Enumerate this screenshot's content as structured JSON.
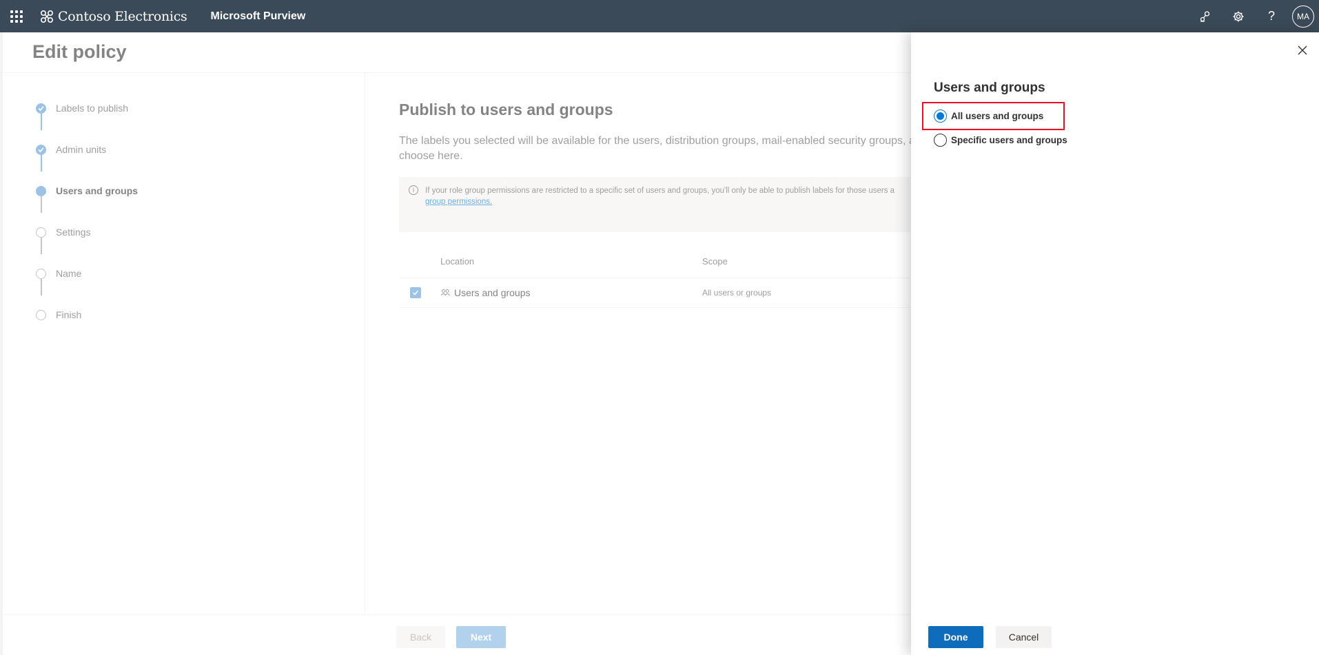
{
  "header": {
    "org_name": "Contoso Electronics",
    "app_name": "Microsoft Purview",
    "avatar_initials": "MA",
    "icons": [
      "waffle-icon",
      "connections-icon",
      "gear-icon",
      "help-icon"
    ],
    "help_glyph": "?"
  },
  "page": {
    "title": "Edit policy"
  },
  "stepper": {
    "steps": [
      {
        "label": "Labels to publish",
        "state": "done"
      },
      {
        "label": "Admin units",
        "state": "done"
      },
      {
        "label": "Users and groups",
        "state": "current"
      },
      {
        "label": "Settings",
        "state": "future"
      },
      {
        "label": "Name",
        "state": "future"
      },
      {
        "label": "Finish",
        "state": "future"
      }
    ]
  },
  "main": {
    "title": "Publish to users and groups",
    "description": "The labels you selected will be available for the users, distribution groups, mail-enabled security groups, a choose here.",
    "info": {
      "text": "If your role group permissions are restricted to a specific set of users and groups, you'll only be able to publish labels for those users a",
      "link": "group permissions."
    },
    "table": {
      "headers": {
        "location": "Location",
        "scope": "Scope"
      },
      "rows": [
        {
          "location": "Users and groups",
          "scope": "All users or groups",
          "checked": true
        }
      ]
    }
  },
  "footer": {
    "back_label": "Back",
    "next_label": "Next"
  },
  "panel": {
    "title": "Users and groups",
    "options": [
      {
        "label": "All users and groups",
        "checked": true
      },
      {
        "label": "Specific users and groups",
        "checked": false
      }
    ],
    "done_label": "Done",
    "cancel_label": "Cancel",
    "highlight_color": "#e81123"
  },
  "colors": {
    "topbar": "#3b4a58",
    "accent": "#0078d4",
    "step_active": "#5a9bd5"
  }
}
